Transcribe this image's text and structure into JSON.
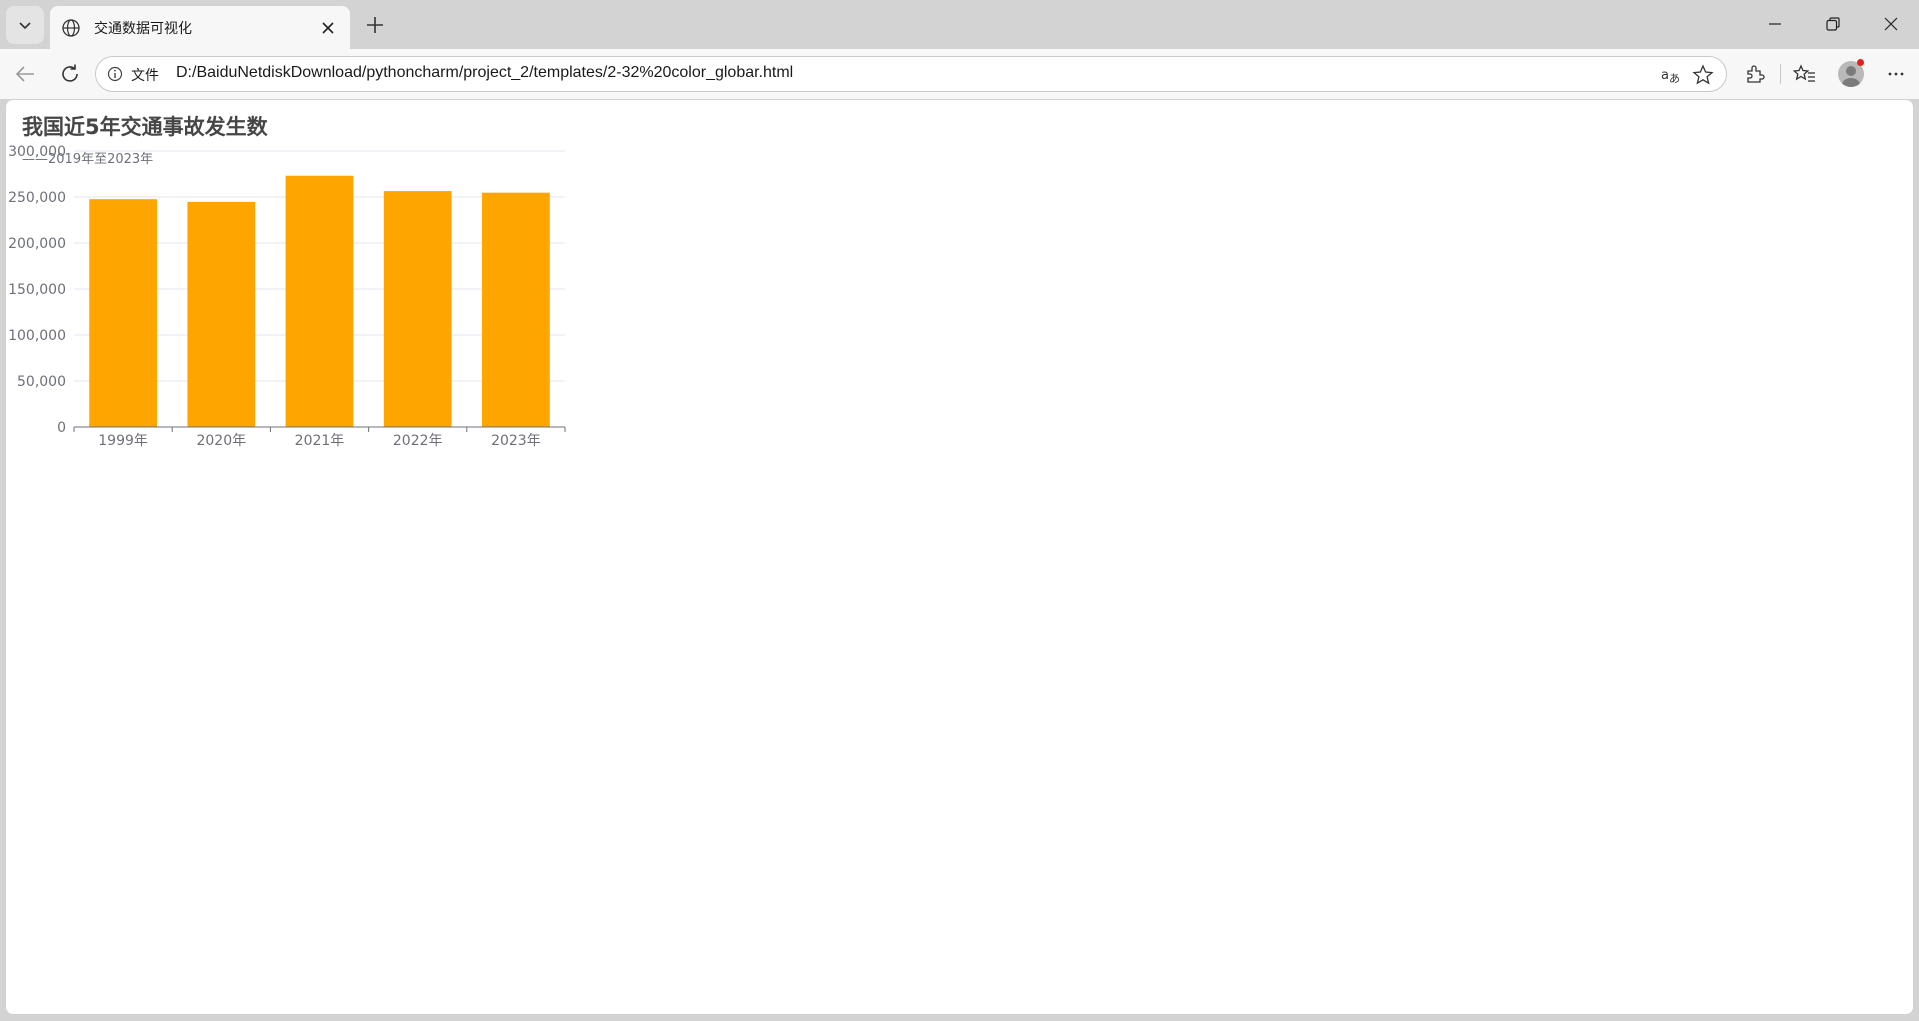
{
  "browser": {
    "tab_title": "交通数据可视化",
    "scheme_label": "文件",
    "url": "D:/BaiduNetdiskDownload/pythoncharm/project_2/templates/2-32%20color_globar.html"
  },
  "chart_data": {
    "type": "bar",
    "title": "我国近5年交通事故发生数",
    "subtitle": "——2019年至2023年",
    "categories": [
      "1999年",
      "2020年",
      "2021年",
      "2022年",
      "2023年"
    ],
    "values": [
      247646,
      244674,
      273098,
      256409,
      254703
    ],
    "ylim": [
      0,
      300000
    ],
    "yticks": [
      "0",
      "50,000",
      "100,000",
      "150,000",
      "200,000",
      "250,000",
      "300,000"
    ],
    "bar_color": "#ffa500",
    "grid": true
  }
}
